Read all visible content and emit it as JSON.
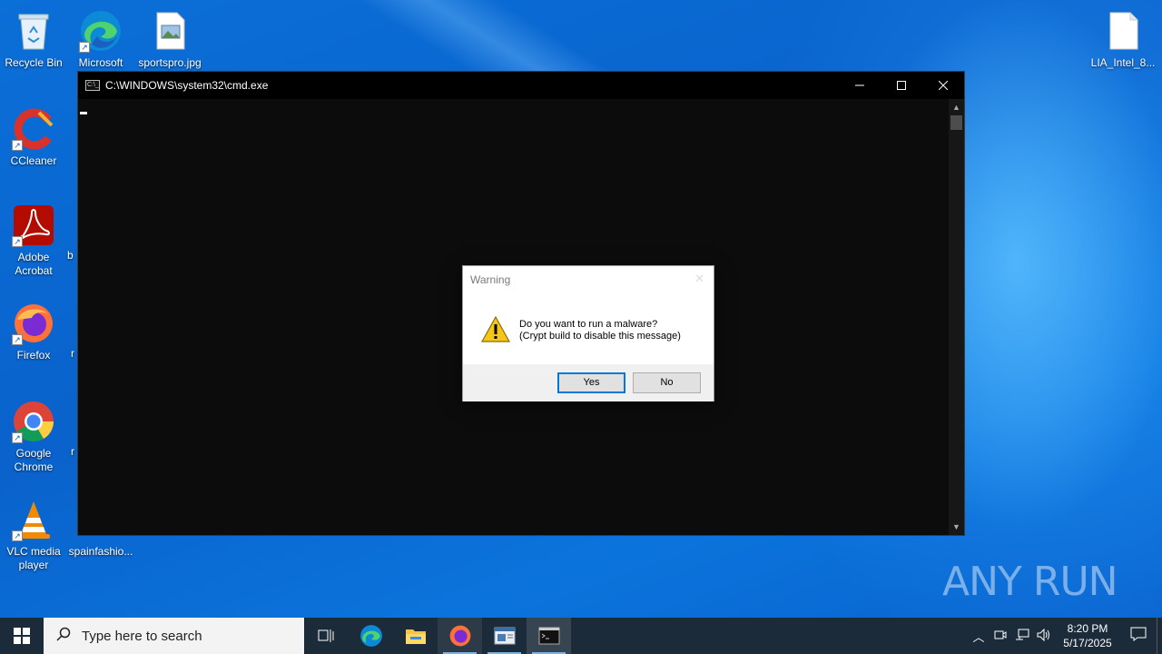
{
  "desktop": {
    "icons": [
      {
        "name": "recycle-bin",
        "label": "Recycle Bin"
      },
      {
        "name": "microsoft-edge",
        "label": "Microsoft Edge"
      },
      {
        "name": "sportspro-jpg",
        "label": "sportspro.jpg"
      },
      {
        "name": "lia-intel",
        "label": "LIA_Intel_8..."
      },
      {
        "name": "ccleaner",
        "label": "CCleaner"
      },
      {
        "name": "adobe-acrobat",
        "label": "Adobe Acrobat"
      },
      {
        "name": "firefox",
        "label": "Firefox"
      },
      {
        "name": "google-chrome",
        "label": "Google Chrome"
      },
      {
        "name": "vlc",
        "label": "VLC media player"
      },
      {
        "name": "spainfashion",
        "label": "spainfashio..."
      }
    ],
    "partial_labels": [
      "b",
      "r",
      "r"
    ]
  },
  "cmd_window": {
    "title": "C:\\WINDOWS\\system32\\cmd.exe",
    "icon_text": "C:\\_"
  },
  "dialog": {
    "title": "Warning",
    "message_line1": "Do you want to run a malware?",
    "message_line2": "(Crypt build to disable this message)",
    "yes_label": "Yes",
    "no_label": "No"
  },
  "watermark": {
    "text": "ANY RUN"
  },
  "taskbar": {
    "search_placeholder": "Type here to search",
    "time": "8:20 PM",
    "date": "5/17/2025",
    "apps": [
      "task-view",
      "edge",
      "file-explorer",
      "firefox",
      "app-window",
      "cmd"
    ]
  },
  "colors": {
    "desktop": "#0a6fd6",
    "taskbar": "#1c2b3a",
    "cmd_bg": "#0c0c0c",
    "accent": "#0078d7"
  }
}
